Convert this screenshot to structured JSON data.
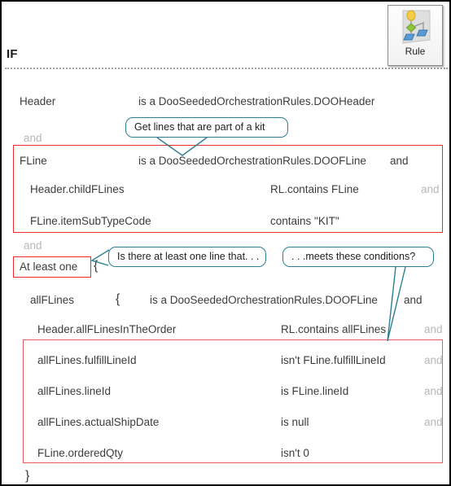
{
  "window": {
    "if_label": "IF"
  },
  "rule_button": {
    "label": "Rule",
    "icon": "rule-diagram-icon"
  },
  "callouts": [
    {
      "id": "kit-callout",
      "text": "Get lines that are part of a kit"
    },
    {
      "id": "atleastone-callout",
      "text": "Is there at least one line that. . ."
    },
    {
      "id": "conditions-callout",
      "text": ". . .meets these conditions?"
    }
  ],
  "conjunctions": {
    "and1": "and",
    "and2": "and"
  },
  "at_least_one": {
    "label": "At least one",
    "brace_open": "{",
    "brace_close": "}"
  },
  "allflines_brace": "{",
  "rows": [
    {
      "id": "header-row",
      "left": "Header",
      "mid": "is a DooSeededOrchestrationRules.DOOHeader",
      "and": ""
    },
    {
      "id": "fline-row",
      "left": "FLine",
      "mid": "is a DooSeededOrchestrationRules.DOOFLine",
      "and": "and"
    },
    {
      "id": "header-childflines-row",
      "left": "Header.childFLines",
      "mid": "RL.contains FLine",
      "and": "and"
    },
    {
      "id": "fline-itemsubtypecode-row",
      "left": "FLine.itemSubTypeCode",
      "mid": "contains \"KIT\"",
      "and": ""
    },
    {
      "id": "allflines-row",
      "left": "allFLines",
      "mid": "is a DooSeededOrchestrationRules.DOOFLine",
      "and": "and"
    },
    {
      "id": "header-allflinesintheorder-row",
      "left": "Header.allFLinesInTheOrder",
      "mid": "RL.contains allFLines",
      "and": "and"
    },
    {
      "id": "allflines-fulfilllineid-row",
      "left": "allFLines.fulfillLineId",
      "mid": "isn't FLine.fulfillLineId",
      "and": "and"
    },
    {
      "id": "allflines-lineid-row",
      "left": "allFLines.lineId",
      "mid": "is FLine.lineId",
      "and": "and"
    },
    {
      "id": "allflines-actualshipdate-row",
      "left": "allFLines.actualShipDate",
      "mid": "is null",
      "and": "and"
    },
    {
      "id": "fline-orderedqty-row",
      "left": "FLine.orderedQty",
      "mid": "isn't 0",
      "and": ""
    }
  ],
  "colors": {
    "highlight_red": "#ee2b2b",
    "callout_teal": "#2c7f91",
    "and_grey": "#b7b7b7",
    "text": "#3c3c3c"
  }
}
